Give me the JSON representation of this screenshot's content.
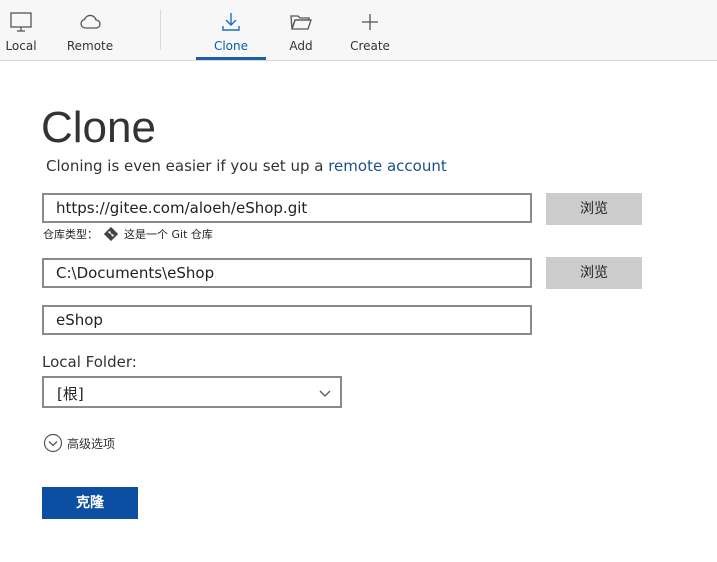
{
  "toolbar": {
    "items": [
      {
        "label": "Local",
        "icon": "monitor-icon"
      },
      {
        "label": "Remote",
        "icon": "cloud-icon"
      },
      {
        "label": "Clone",
        "icon": "download-icon"
      },
      {
        "label": "Add",
        "icon": "folder-open-icon"
      },
      {
        "label": "Create",
        "icon": "plus-icon"
      }
    ],
    "active": "Clone",
    "accent_color": "#1a5ea8"
  },
  "main": {
    "title": "Clone",
    "subtitle_prefix": "Cloning is even easier if you set up a ",
    "subtitle_link": "remote account",
    "source_url": "https://gitee.com/aloeh/eShop.git",
    "browse_label": "浏览",
    "repo_type_label": "仓库类型：",
    "repo_type_value": "这是一个 Git 仓库",
    "destination_path": "C:\\Documents\\eShop",
    "name": "eShop",
    "local_folder_label": "Local Folder:",
    "local_folder_value": "[根]",
    "advanced_label": "高级选项",
    "clone_button_label": "克隆",
    "clone_button_color": "#0b4ea2"
  }
}
